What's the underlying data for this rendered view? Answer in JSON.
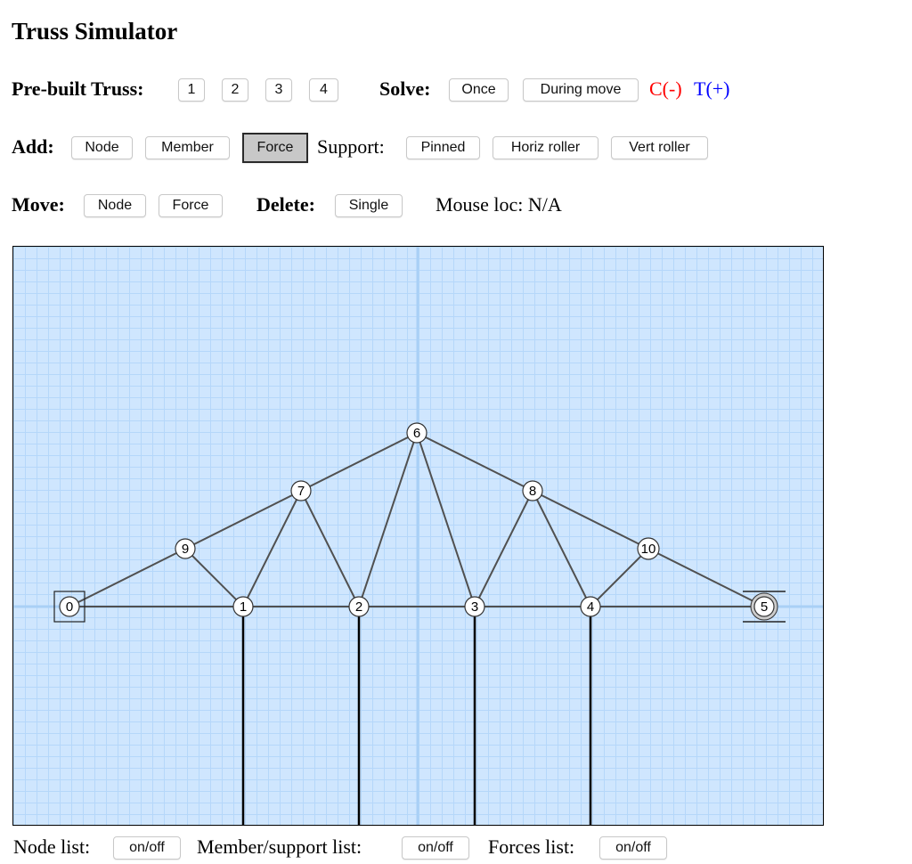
{
  "app": {
    "title": "Truss Simulator"
  },
  "row1": {
    "prebuilt_label": "Pre-built Truss:",
    "prebuilt_buttons": [
      "1",
      "2",
      "3",
      "4"
    ],
    "solve_label": "Solve:",
    "solve_once": "Once",
    "solve_during_move": "During move",
    "compression": "C(-)",
    "tension": "T(+)"
  },
  "row2": {
    "add_label": "Add:",
    "node": "Node",
    "member": "Member",
    "force": "Force",
    "force_selected": true,
    "support_label": "Support:",
    "pinned": "Pinned",
    "horiz_roller": "Horiz roller",
    "vert_roller": "Vert roller"
  },
  "row3": {
    "move_label": "Move:",
    "move_node": "Node",
    "move_force": "Force",
    "delete_label": "Delete:",
    "delete_single": "Single",
    "mouse_loc": "Mouse loc: N/A"
  },
  "bottom": {
    "node_list": "Node list:",
    "member_list": "Member/support list:",
    "forces_list": "Forces list:",
    "toggle": "on/off"
  },
  "colors": {
    "compression": "#ff0000",
    "tension": "#0000ff",
    "canvas_bg": "#cfe6fe",
    "grid_minor": "#b5d7fa",
    "grid_major": "#a9d0f6",
    "member": "#505050"
  },
  "truss": {
    "nodes": [
      {
        "id": "0",
        "x": 0,
        "y": 0,
        "support": "pinned"
      },
      {
        "id": "1",
        "x": 6,
        "y": 0
      },
      {
        "id": "2",
        "x": 10,
        "y": 0
      },
      {
        "id": "3",
        "x": 14,
        "y": 0
      },
      {
        "id": "4",
        "x": 18,
        "y": 0
      },
      {
        "id": "5",
        "x": 24,
        "y": 0,
        "support": "horiz-roller"
      },
      {
        "id": "6",
        "x": 12,
        "y": 6
      },
      {
        "id": "7",
        "x": 8,
        "y": 4
      },
      {
        "id": "8",
        "x": 16,
        "y": 4
      },
      {
        "id": "9",
        "x": 4,
        "y": 2
      },
      {
        "id": "10",
        "x": 20,
        "y": 2
      }
    ],
    "members": [
      [
        "0",
        "1"
      ],
      [
        "1",
        "2"
      ],
      [
        "2",
        "3"
      ],
      [
        "3",
        "4"
      ],
      [
        "4",
        "5"
      ],
      [
        "0",
        "9"
      ],
      [
        "9",
        "7"
      ],
      [
        "7",
        "6"
      ],
      [
        "6",
        "8"
      ],
      [
        "8",
        "10"
      ],
      [
        "10",
        "5"
      ],
      [
        "9",
        "1"
      ],
      [
        "1",
        "7"
      ],
      [
        "7",
        "2"
      ],
      [
        "2",
        "6"
      ],
      [
        "6",
        "3"
      ],
      [
        "3",
        "8"
      ],
      [
        "8",
        "4"
      ],
      [
        "4",
        "10"
      ]
    ],
    "forces": [
      {
        "node": "1",
        "direction": "down"
      },
      {
        "node": "2",
        "direction": "down"
      },
      {
        "node": "3",
        "direction": "down"
      },
      {
        "node": "4",
        "direction": "down"
      }
    ]
  }
}
